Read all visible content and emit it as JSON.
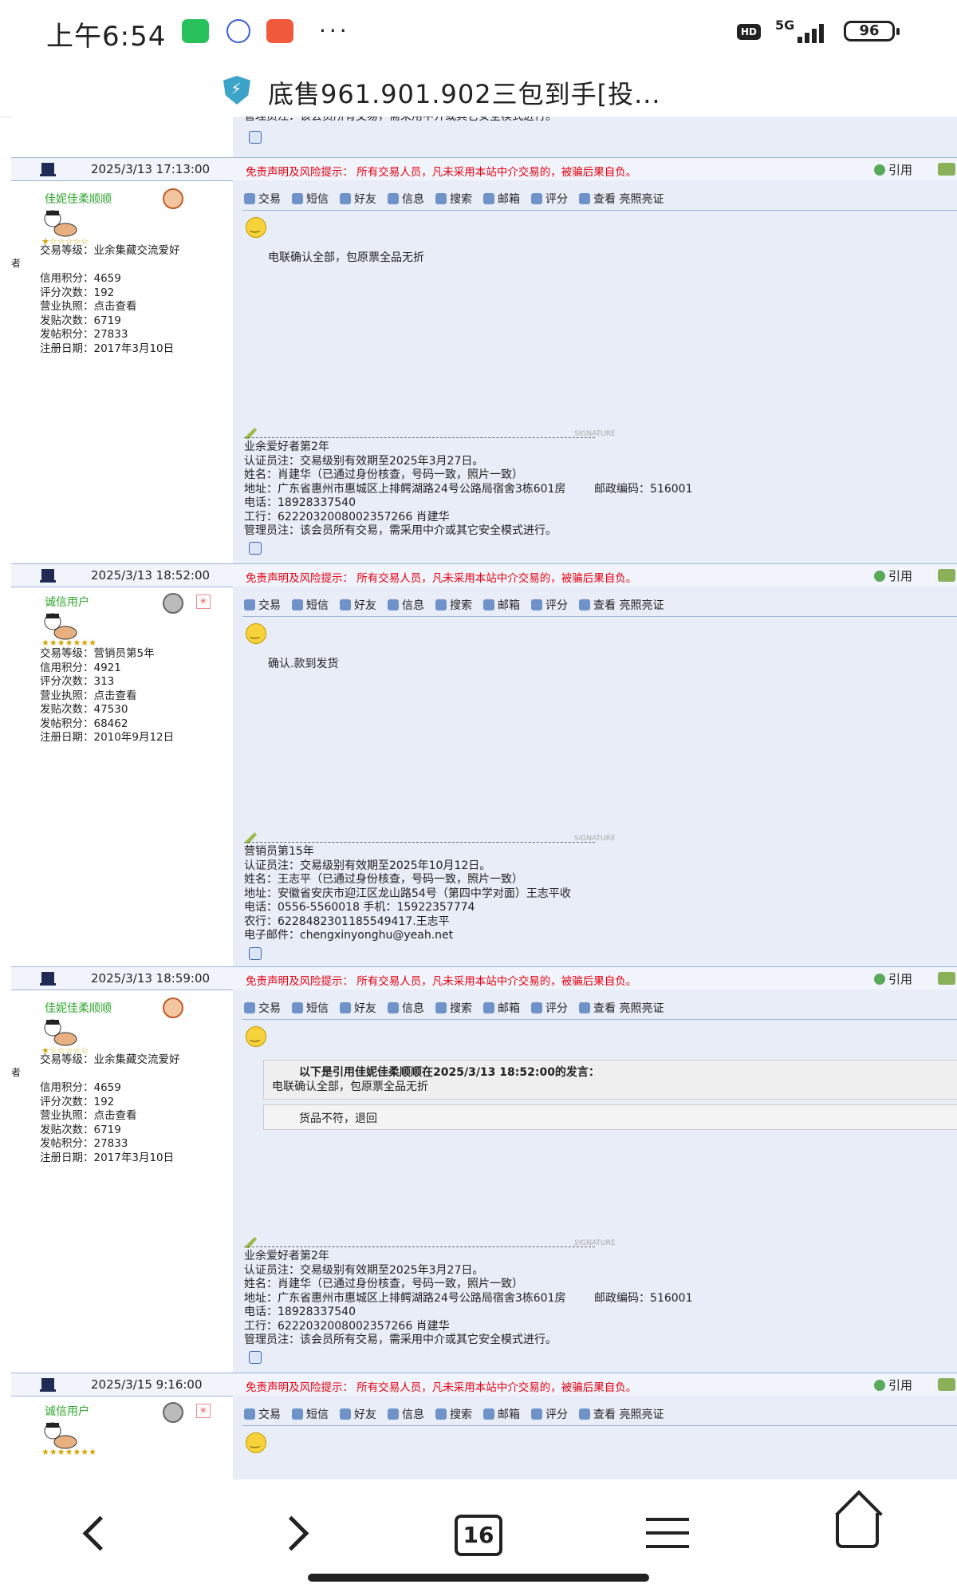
{
  "status": {
    "time": "上午6:54",
    "dots": "···",
    "hd": "HD",
    "net": "5G",
    "battery": "96"
  },
  "title_bar": {
    "title": "底售961.901.902三包到手[投..."
  },
  "common": {
    "warning": "免责声明及风险提示： 所有交易人员，凡未采用本站中介交易的，被骗后果自负。",
    "quote_label": "引用",
    "toolbar": [
      "交易",
      "短信",
      "好友",
      "信息",
      "搜索",
      "邮箱",
      "评分",
      "查看 亮照亮证"
    ],
    "sig_label": "SIGNATURE"
  },
  "top_partial": {
    "text": "管理员注：该会员所有交易，需采用中介或其它安全模式进行。"
  },
  "posts": [
    {
      "date": "2025/3/13 17:13:00",
      "username": "佳妮佳柔顺顺",
      "side": "者",
      "stars": "★☆☆☆☆☆",
      "stats": "交易等级：业余集藏交流爱好\n\n信用积分：4659\n评分次数：192\n营业执照：点击查看\n发贴次数：6719\n发帖积分：27833\n注册日期：2017年3月10日",
      "content": "电联确认全部，包原票全品无折",
      "sig": "业余爱好者第2年\n认证员注：交易级别有效期至2025年3月27日。\n姓名：肖建华（已通过身份核查，号码一致，照片一致）\n地址：广东省惠州市惠城区上排鳄湖路24号公路局宿舍3栋601房        邮政编码：516001\n电话：18928337540\n工行：6222032008002357266 肖建华\n管理员注：该会员所有交易，需采用中介或其它安全模式进行。"
    },
    {
      "date": "2025/3/13 18:52:00",
      "username": "诚信用户",
      "stars": "★★★★★★★",
      "stats": "交易等级：营销员第5年\n信用积分：4921\n评分次数：313\n营业执照：点击查看\n发贴次数：47530\n发帖积分：68462\n注册日期：2010年9月12日",
      "content": "确认.款到发货",
      "sig": "营销员第15年\n认证员注：交易级别有效期至2025年10月12日。\n姓名：王志平（已通过身份核查，号码一致，照片一致）\n地址：安徽省安庆市迎江区龙山路54号（第四中学对面）王志平收\n电话：0556-5560018 手机：15922357774\n农行：6228482301185549417.王志平\n电子邮件：chengxinyonghu@yeah.net"
    },
    {
      "date": "2025/3/13 18:59:00",
      "username": "佳妮佳柔顺顺",
      "side": "者",
      "stars": "★☆☆☆☆☆",
      "stats": "交易等级：业余集藏交流爱好\n\n信用积分：4659\n评分次数：192\n营业执照：点击查看\n发贴次数：6719\n发帖积分：27833\n注册日期：2017年3月10日",
      "quote_header": "以下是引用佳妮佳柔顺顺在2025/3/13 18:52:00的发言：",
      "quote_text": "电联确认全部，包原票全品无折",
      "content": "货品不符，退回",
      "sig": "业余爱好者第2年\n认证员注：交易级别有效期至2025年3月27日。\n姓名：肖建华（已通过身份核查，号码一致，照片一致）\n地址：广东省惠州市惠城区上排鳄湖路24号公路局宿舍3栋601房        邮政编码：516001\n电话：18928337540\n工行：6222032008002357266 肖建华\n管理员注：该会员所有交易，需采用中介或其它安全模式进行。"
    },
    {
      "date": "2025/3/15 9:16:00",
      "username": "诚信用户",
      "stars": "★★★★★★★"
    }
  ],
  "nav": {
    "tabs": "16"
  }
}
